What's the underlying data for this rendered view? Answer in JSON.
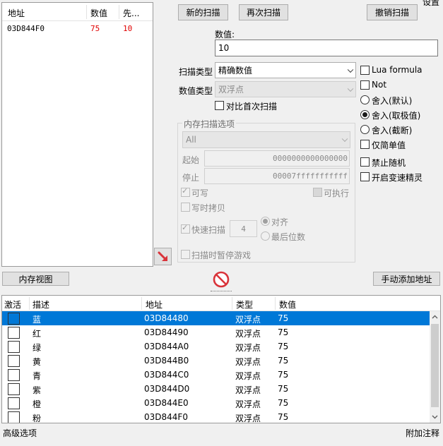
{
  "window": {
    "settings_label": "设置"
  },
  "scan_results": {
    "headers": {
      "address": "地址",
      "value": "数值",
      "previous": "先..."
    },
    "rows": [
      {
        "address": "03D844F0",
        "value": "75",
        "previous": "10"
      }
    ]
  },
  "toolbar": {
    "new_scan": "新的扫描",
    "next_scan": "再次扫描",
    "undo_scan": "撤销扫描"
  },
  "value_field": {
    "label": "数值:",
    "value": "10"
  },
  "scan_type": {
    "label": "扫描类型",
    "selected": "精确数值"
  },
  "value_type": {
    "label": "数值类型",
    "selected": "双浮点"
  },
  "compare_first_label": "对比首次扫描",
  "memory_options": {
    "title": "内存扫描选项",
    "region": "All",
    "start_label": "起始",
    "start_value": "0000000000000000",
    "stop_label": "停止",
    "stop_value": "00007fffffffffff",
    "writable": "可写",
    "executable": "可执行",
    "copy_on_write": "写时拷贝",
    "fast_scan": "快速扫描",
    "fast_scan_value": "4",
    "align": "对齐",
    "last_digits": "最后位数",
    "pause_game": "扫描时暂停游戏"
  },
  "right_options": {
    "lua_formula": "Lua formula",
    "not": "Not",
    "round_default": "舍入(默认)",
    "round_extreme": "舍入(取极值)",
    "round_truncate": "舍入(截断)",
    "simple_value": "仅简单值",
    "no_random": "禁止随机",
    "speed_hack": "开启变速精灵"
  },
  "memory_view_button": "内存视图",
  "add_address_button": "手动添加地址",
  "address_list": {
    "headers": {
      "active": "激活",
      "description": "描述",
      "address": "地址",
      "type": "类型",
      "value": "数值"
    },
    "rows": [
      {
        "description": "蓝",
        "address": "03D84480",
        "type": "双浮点",
        "value": "75"
      },
      {
        "description": "红",
        "address": "03D84490",
        "type": "双浮点",
        "value": "75"
      },
      {
        "description": "绿",
        "address": "03D844A0",
        "type": "双浮点",
        "value": "75"
      },
      {
        "description": "黄",
        "address": "03D844B0",
        "type": "双浮点",
        "value": "75"
      },
      {
        "description": "青",
        "address": "03D844C0",
        "type": "双浮点",
        "value": "75"
      },
      {
        "description": "紫",
        "address": "03D844D0",
        "type": "双浮点",
        "value": "75"
      },
      {
        "description": "橙",
        "address": "03D844E0",
        "type": "双浮点",
        "value": "75"
      },
      {
        "description": "粉",
        "address": "03D844F0",
        "type": "双浮点",
        "value": "75"
      }
    ]
  },
  "footer": {
    "advanced": "高级选项",
    "comments": "附加注释"
  },
  "colors": {
    "accent": "#0078d7",
    "result_value": "#e00000",
    "arrow": "#d9333a"
  }
}
